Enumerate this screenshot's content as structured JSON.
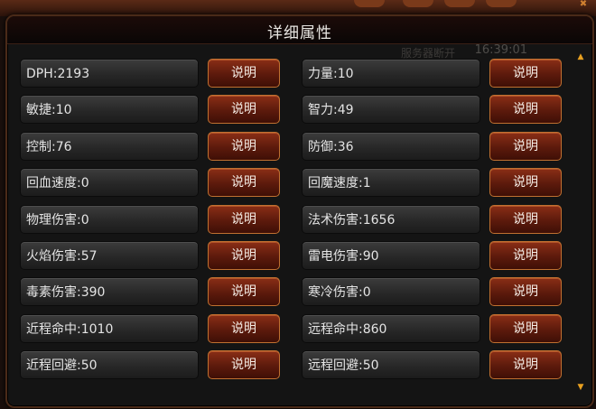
{
  "window": {
    "title": "详细属性",
    "status_text": "服务器断开",
    "clock": "16:39:01"
  },
  "button_label": "说明",
  "attributes_left": [
    {
      "label": "DPH:2193"
    },
    {
      "label": "敏捷:10"
    },
    {
      "label": "控制:76"
    },
    {
      "label": "回血速度:0"
    },
    {
      "label": "物理伤害:0"
    },
    {
      "label": "火焰伤害:57"
    },
    {
      "label": "毒素伤害:390"
    },
    {
      "label": "近程命中:1010"
    },
    {
      "label": "近程回避:50"
    }
  ],
  "attributes_right": [
    {
      "label": "力量:10"
    },
    {
      "label": "智力:49"
    },
    {
      "label": "防御:36"
    },
    {
      "label": "回魔速度:1"
    },
    {
      "label": "法术伤害:1656"
    },
    {
      "label": "雷电伤害:90"
    },
    {
      "label": "寒冷伤害:0"
    },
    {
      "label": "远程命中:860"
    },
    {
      "label": "远程回避:50"
    }
  ],
  "icons": {
    "scroll_up": "scroll-up-arrow-icon",
    "scroll_down": "scroll-down-arrow-icon",
    "corner": "close-corner-icon"
  },
  "colors": {
    "button": "#6a1f0e",
    "button_border": "#c07030",
    "accent": "#e8a020"
  }
}
